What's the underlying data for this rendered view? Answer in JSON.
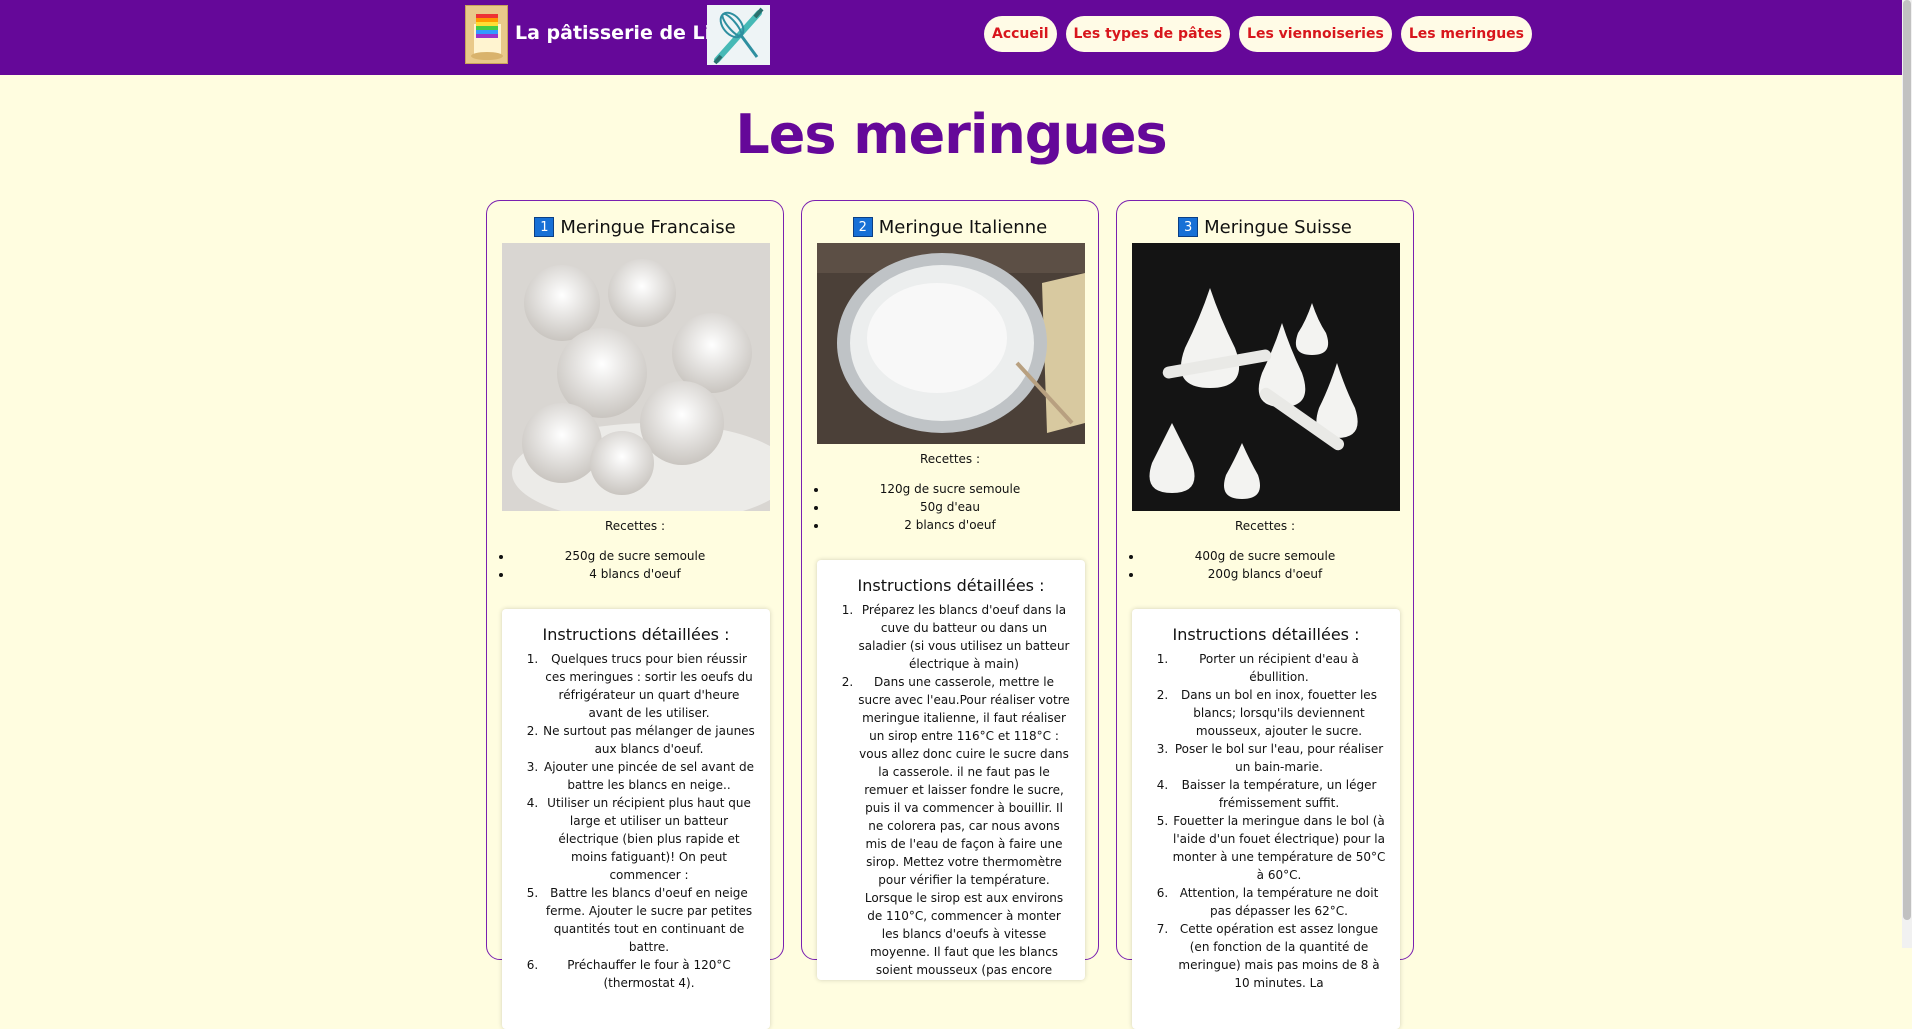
{
  "header": {
    "site_title": "La pâtisserie de Lionel",
    "logo_icon": "rainbow-cake-icon",
    "tools_icon": "whisk-rolling-pin-icon",
    "nav": [
      {
        "label": "Accueil"
      },
      {
        "label": "Les types de pâtes"
      },
      {
        "label": "Les viennoiseries"
      },
      {
        "label": "Les meringues"
      }
    ]
  },
  "page_title": "Les meringues",
  "cards": [
    {
      "number": "1",
      "title": "Meringue Francaise",
      "recettes_label": "Recettes :",
      "ingredients": [
        "250g de sucre semoule",
        "4 blancs d'oeuf"
      ],
      "instructions_title": "Instructions détaillées :",
      "instructions": [
        "Quelques trucs pour bien réussir ces meringues : sortir les oeufs du réfrigérateur un quart d'heure avant de les utiliser.",
        "Ne surtout pas mélanger de jaunes aux blancs d'oeuf.",
        "Ajouter une pincée de sel avant de battre les blancs en neige..",
        "Utiliser un récipient plus haut que large et utiliser un batteur électrique (bien plus rapide et moins fatiguant)! On peut commencer :",
        "Battre les blancs d'oeuf en neige ferme. Ajouter le sucre par petites quantités tout en continuant de battre.",
        "Préchauffer le four à 120°C (thermostat 4)."
      ]
    },
    {
      "number": "2",
      "title": "Meringue Italienne",
      "recettes_label": "Recettes :",
      "ingredients": [
        "120g de sucre semoule",
        "50g d'eau",
        "2 blancs d'oeuf"
      ],
      "instructions_title": "Instructions détaillées :",
      "instructions": [
        "Préparez les blancs d'oeuf dans la cuve du batteur ou dans un saladier (si vous utilisez un batteur électrique à main)",
        "Dans une casserole, mettre le sucre avec l'eau.Pour réaliser votre meringue italienne, il faut réaliser un sirop entre 116°C et 118°C : vous allez donc cuire le sucre dans la casserole. il ne faut pas le remuer et laisser fondre le sucre, puis il va commencer à bouillir. Il ne colorera pas, car nous avons mis de l'eau de façon à faire une sirop. Mettez votre thermomètre pour vérifier la température. Lorsque le sirop est aux environs de 110°C, commencer à monter les blancs d'oeufs à vitesse moyenne. Il faut que les blancs soient mousseux (pas encore blancs, ça doit ressembler à la"
      ]
    },
    {
      "number": "3",
      "title": "Meringue Suisse",
      "recettes_label": "Recettes :",
      "ingredients": [
        "400g de sucre semoule",
        "200g blancs d'oeuf"
      ],
      "instructions_title": "Instructions détaillées :",
      "instructions": [
        "Porter un récipient d'eau à ébullition.",
        "Dans un bol en inox, fouetter les blancs; lorsqu'ils deviennent mousseux, ajouter le sucre.",
        "Poser le bol sur l'eau, pour réaliser un bain-marie.",
        "Baisser la température, un léger frémissement suffit.",
        "Fouetter la meringue dans le bol (à l'aide d'un fouet électrique) pour la monter à une température de 50°C à 60°C.",
        "Attention, la température ne doit pas dépasser les 62°C.",
        "Cette opération est assez longue (en fonction de la quantité de meringue) mais pas moins de 8 à 10 minutes. La"
      ]
    }
  ]
}
